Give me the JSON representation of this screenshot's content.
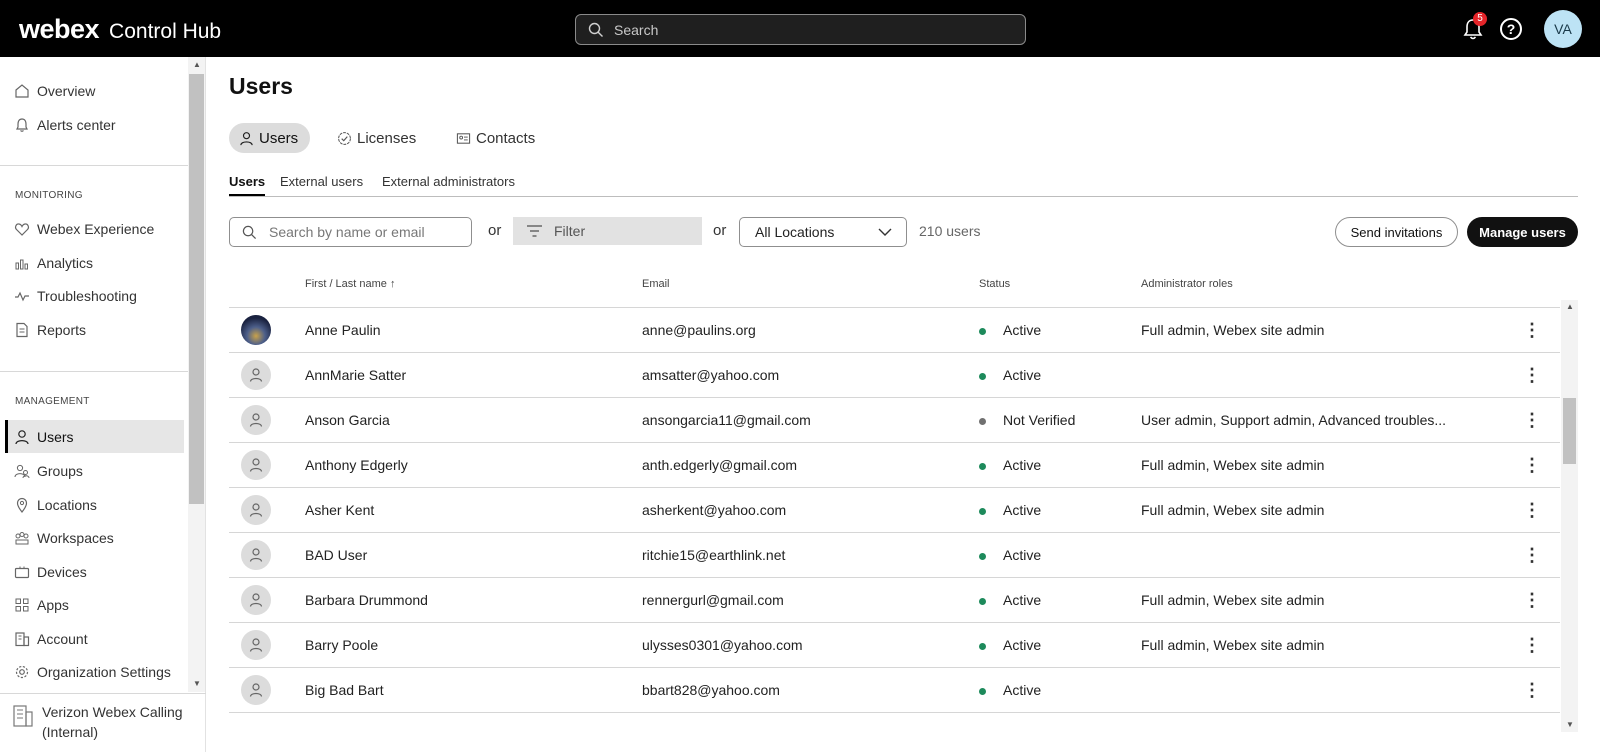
{
  "header": {
    "brand": "webex",
    "product": "Control Hub",
    "search_placeholder": "Search",
    "notification_count": "5",
    "help_glyph": "?",
    "user_initials": "VA"
  },
  "sidebar": {
    "top_items": [
      {
        "label": "Overview",
        "icon": "home-icon"
      },
      {
        "label": "Alerts center",
        "icon": "bell-icon"
      }
    ],
    "monitoring_label": "MONITORING",
    "monitoring_items": [
      {
        "label": "Webex Experience",
        "icon": "heart-icon"
      },
      {
        "label": "Analytics",
        "icon": "bar-chart-icon"
      },
      {
        "label": "Troubleshooting",
        "icon": "pulse-icon"
      },
      {
        "label": "Reports",
        "icon": "document-icon"
      }
    ],
    "management_label": "MANAGEMENT",
    "management_items": [
      {
        "label": "Users",
        "icon": "user-icon",
        "active": true
      },
      {
        "label": "Groups",
        "icon": "group-icon"
      },
      {
        "label": "Locations",
        "icon": "location-pin-icon"
      },
      {
        "label": "Workspaces",
        "icon": "workspace-icon"
      },
      {
        "label": "Devices",
        "icon": "device-icon"
      },
      {
        "label": "Apps",
        "icon": "apps-icon"
      },
      {
        "label": "Account",
        "icon": "building-icon"
      },
      {
        "label": "Organization Settings",
        "icon": "gear-icon"
      }
    ],
    "org_name": "Verizon Webex Calling (Internal)"
  },
  "main": {
    "title": "Users",
    "tabs": [
      {
        "label": "Users",
        "active": true
      },
      {
        "label": "Licenses"
      },
      {
        "label": "Contacts"
      }
    ],
    "subtabs": [
      {
        "label": "Users",
        "active": true
      },
      {
        "label": "External users"
      },
      {
        "label": "External administrators"
      }
    ],
    "search_placeholder": "Search by name or email",
    "or_label": "or",
    "filter_label": "Filter",
    "location_selected": "All Locations",
    "user_count": "210 users",
    "send_invitations_label": "Send invitations",
    "manage_users_label": "Manage users"
  },
  "table": {
    "columns": {
      "name": "First / Last name ↑",
      "email": "Email",
      "status": "Status",
      "roles": "Administrator roles"
    },
    "rows": [
      {
        "name": "Anne Paulin",
        "email": "anne@paulins.org",
        "status": "Active",
        "roles": "Full admin, Webex site admin",
        "photo": true
      },
      {
        "name": "AnnMarie Satter",
        "email": "amsatter@yahoo.com",
        "status": "Active",
        "roles": ""
      },
      {
        "name": "Anson Garcia",
        "email": "ansongarcia11@gmail.com",
        "status": "Not Verified",
        "roles": "User admin, Support admin, Advanced troubles..."
      },
      {
        "name": "Anthony Edgerly",
        "email": "anth.edgerly@gmail.com",
        "status": "Active",
        "roles": "Full admin, Webex site admin"
      },
      {
        "name": "Asher Kent",
        "email": "asherkent@yahoo.com",
        "status": "Active",
        "roles": "Full admin, Webex site admin"
      },
      {
        "name": "BAD User",
        "email": "ritchie15@earthlink.net",
        "status": "Active",
        "roles": ""
      },
      {
        "name": "Barbara Drummond",
        "email": "rennergurl@gmail.com",
        "status": "Active",
        "roles": "Full admin, Webex site admin"
      },
      {
        "name": "Barry Poole",
        "email": "ulysses0301@yahoo.com",
        "status": "Active",
        "roles": "Full admin, Webex site admin"
      },
      {
        "name": "Big Bad Bart",
        "email": "bbart828@yahoo.com",
        "status": "Active",
        "roles": ""
      }
    ],
    "status_colors": {
      "Active": "#1d8a5b",
      "Not Verified": "#707070"
    }
  }
}
